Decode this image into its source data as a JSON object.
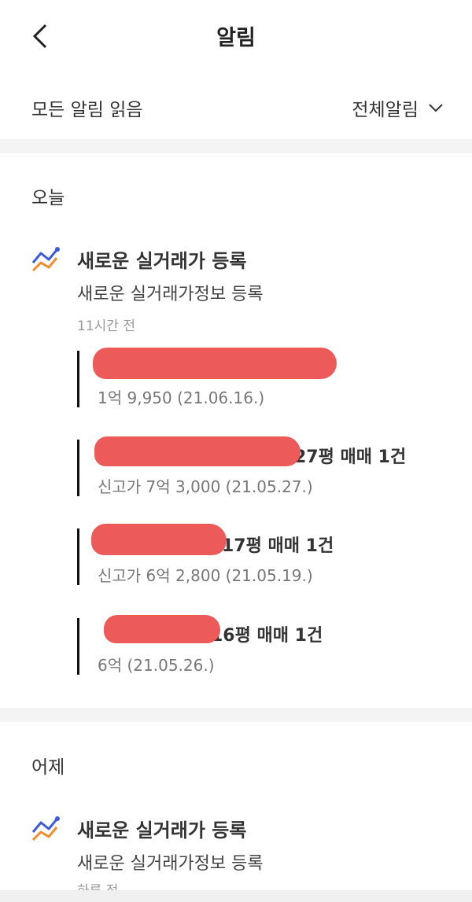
{
  "header": {
    "title": "알림"
  },
  "toolbar": {
    "read_all_label": "모든 알림 읽음",
    "filter_label": "전체알림"
  },
  "sections": [
    {
      "label": "오늘",
      "notification": {
        "title": "새로운 실거래가 등록",
        "subtitle": "새로운 실거래가정보 등록",
        "time": "11시간 전",
        "deals": [
          {
            "title_visible": "",
            "price": "1억 9,950 (21.06.16.)"
          },
          {
            "title_visible": "27평 매매 1건",
            "price": "신고가 7억 3,000 (21.05.27.)"
          },
          {
            "title_visible": "17평 매매 1건",
            "price": "신고가 6억 2,800 (21.05.19.)"
          },
          {
            "title_visible": "16평 매매 1건",
            "price": "6억 (21.05.26.)"
          }
        ]
      }
    },
    {
      "label": "어제",
      "notification": {
        "title": "새로운 실거래가 등록",
        "subtitle": "새로운 실거래가정보 등록",
        "time": "하루 전"
      }
    }
  ],
  "icons": {
    "back": "chevron-left-icon",
    "filter": "chevron-down-icon",
    "notif": "price-trend-icon"
  },
  "colors": {
    "redaction": "#ec5a5a",
    "trend_blue": "#3b5bdb",
    "trend_orange": "#f08c2b"
  }
}
